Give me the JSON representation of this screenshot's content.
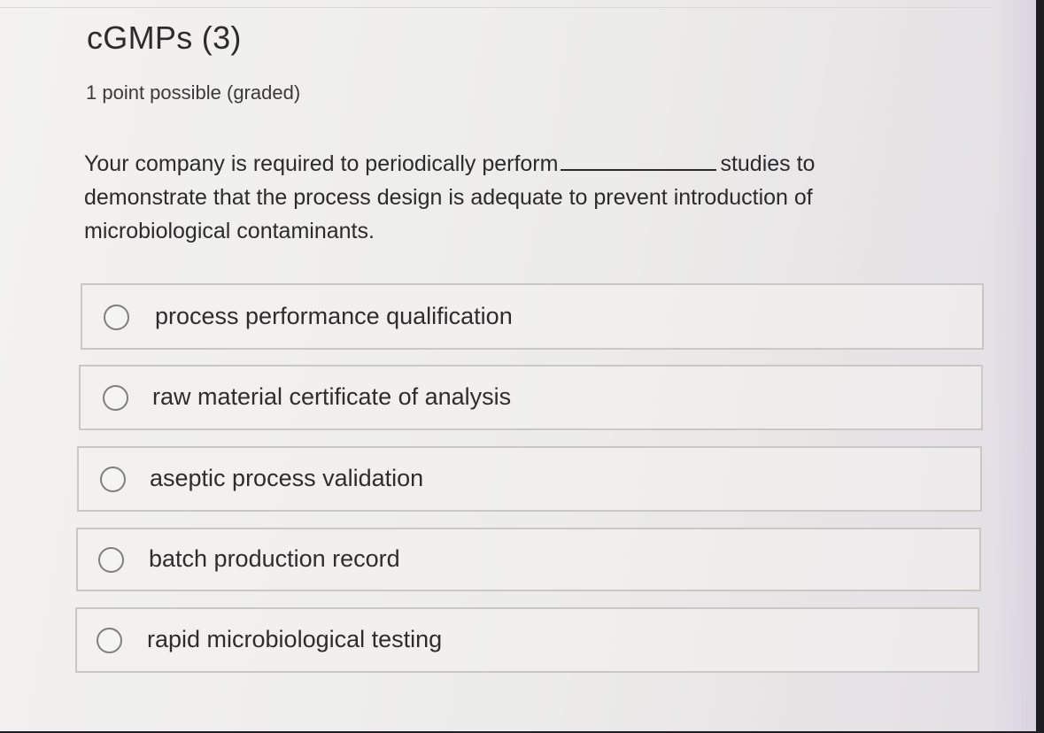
{
  "problem": {
    "title": "cGMPs (3)",
    "points": "1 point possible (graded)",
    "question_before": "Your company is required to periodically perform",
    "question_after": "studies to demonstrate that the process design is adequate to prevent introduction of microbiological contaminants.",
    "options": [
      {
        "label": "process performance qualification",
        "selected": false
      },
      {
        "label": "raw material certificate of analysis",
        "selected": false
      },
      {
        "label": "aseptic process validation",
        "selected": false
      },
      {
        "label": "batch production record",
        "selected": false
      },
      {
        "label": "rapid microbiological testing",
        "selected": false
      }
    ]
  },
  "colors": {
    "page_background": "#efeeec",
    "text": "#2b2b2d",
    "option_border": "#c9c8c5",
    "radio_border": "#7f7f82"
  }
}
